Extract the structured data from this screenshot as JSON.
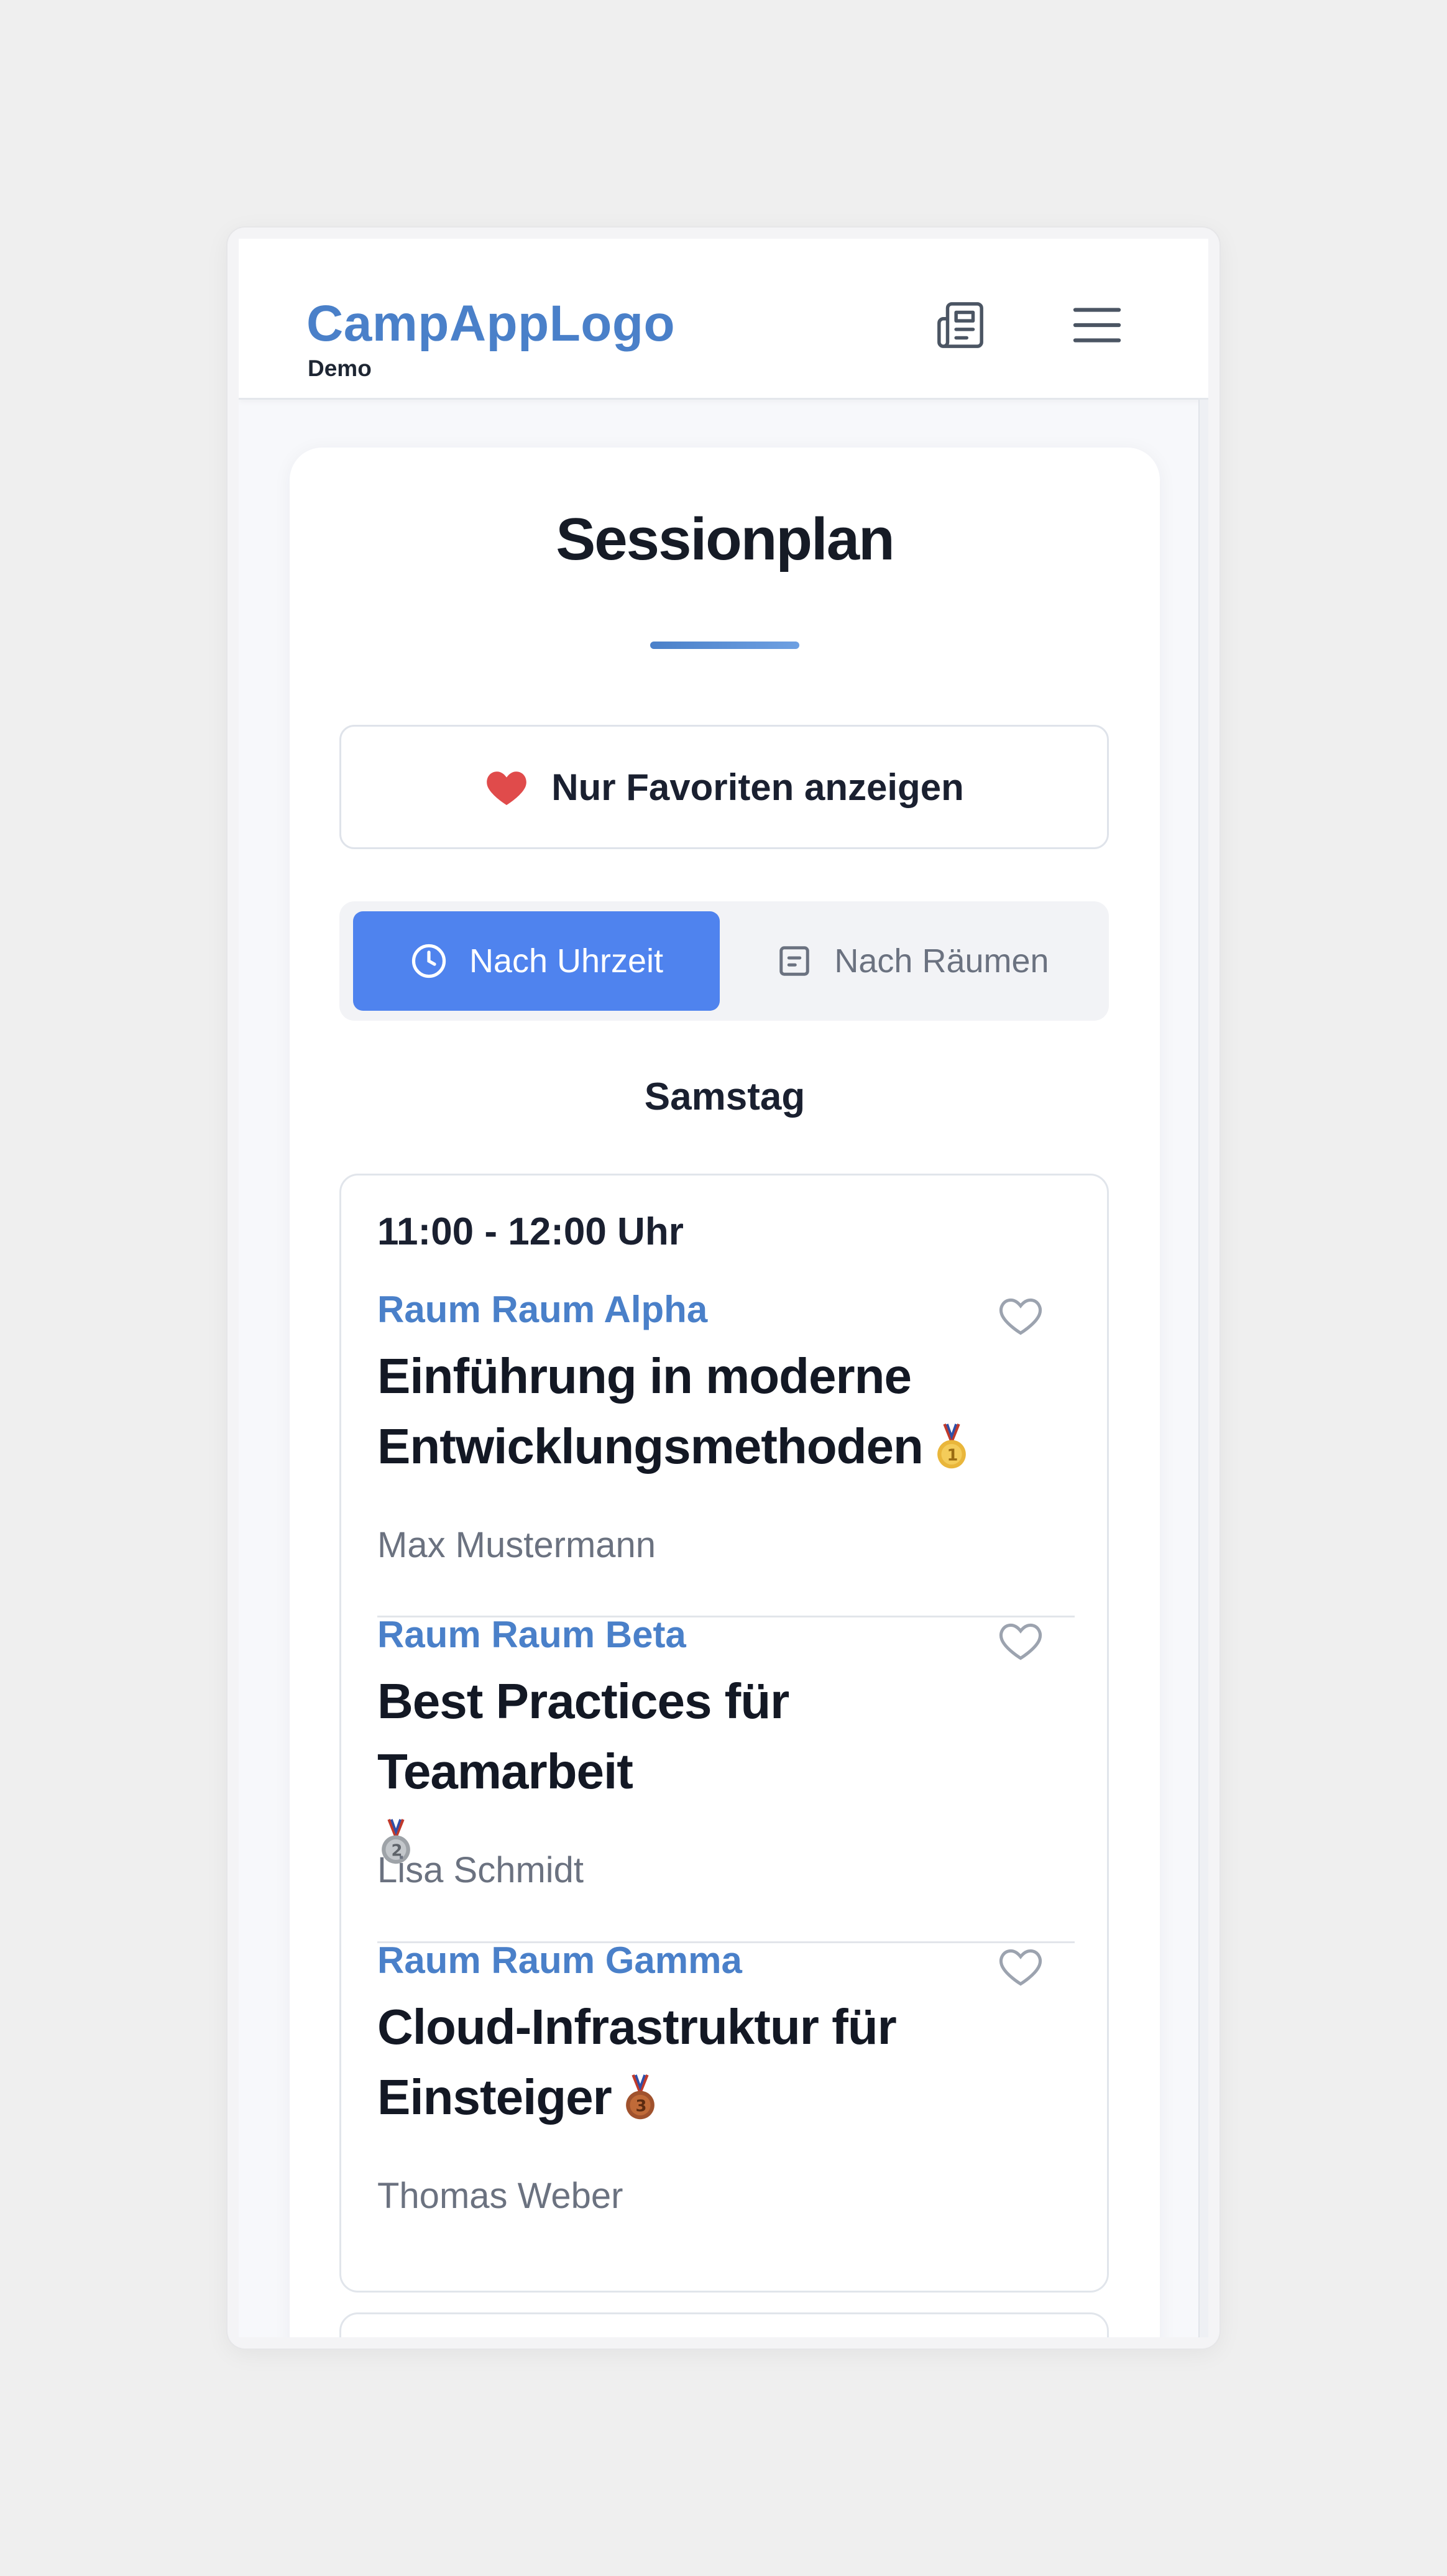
{
  "header": {
    "logo_text": "CampAppLogo",
    "logo_subtitle": "Demo",
    "news_icon": "newspaper-icon",
    "menu_icon": "hamburger-menu-icon"
  },
  "page": {
    "title": "Sessionplan"
  },
  "favorites_filter": {
    "label": "Nur Favoriten anzeigen",
    "icon": "heart-filled-icon",
    "icon_color": "#e04b4b"
  },
  "view_toggle": {
    "options": [
      {
        "label": "Nach Uhrzeit",
        "icon": "clock-icon",
        "active": true
      },
      {
        "label": "Nach Räumen",
        "icon": "room-door-icon",
        "active": false
      }
    ]
  },
  "schedule": {
    "day": "Samstag",
    "slots": [
      {
        "time": "11:00 - 12:00 Uhr",
        "sessions": [
          {
            "room": "Raum Raum Alpha",
            "title": "Einführung in moderne Entwicklungsmethoden",
            "medal": "gold-medal-icon",
            "speaker": "Max Mustermann",
            "favorite": false
          },
          {
            "room": "Raum Raum Beta",
            "title": "Best Practices für Teamarbeit",
            "medal": "silver-medal-icon",
            "speaker": "Lisa Schmidt",
            "favorite": false
          },
          {
            "room": "Raum Raum Gamma",
            "title": "Cloud-Infrastruktur für Einsteiger",
            "medal": "bronze-medal-icon",
            "speaker": "Thomas Weber",
            "favorite": false
          }
        ]
      }
    ]
  },
  "colors": {
    "brand": "#4a80c9",
    "active_toggle": "#4f83ee",
    "text_dark": "#131824",
    "text_muted": "#6b7280"
  }
}
